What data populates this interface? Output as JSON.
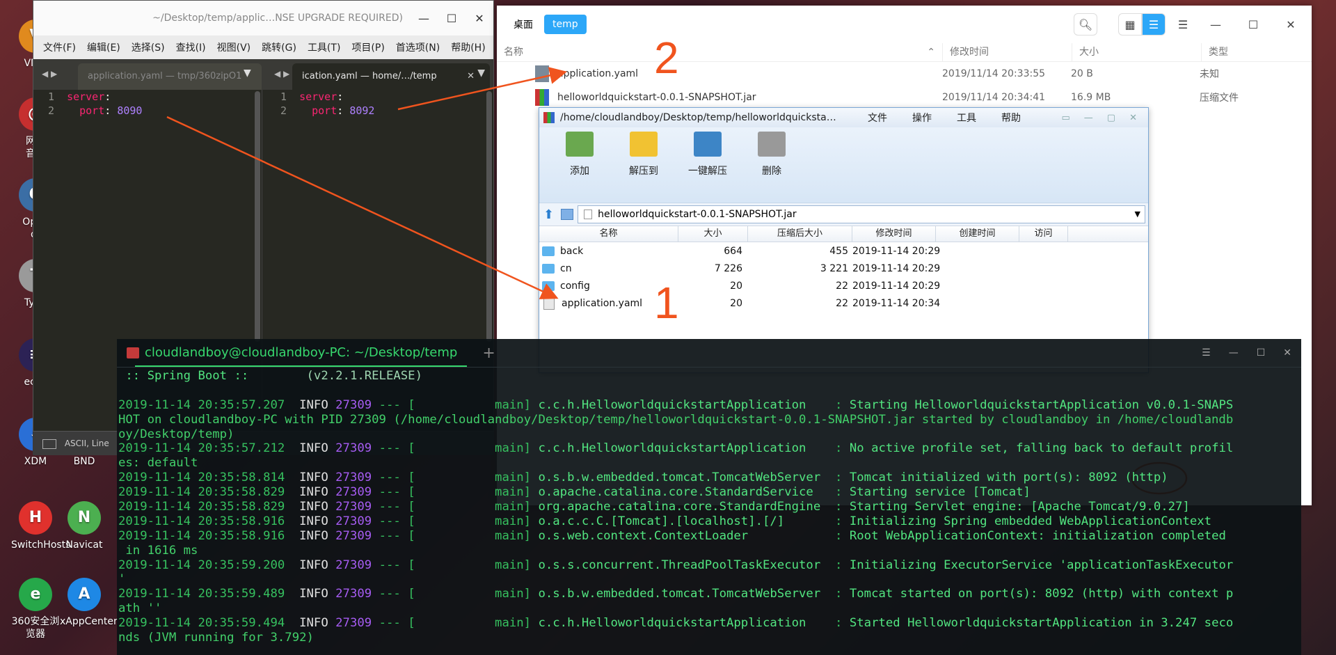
{
  "desktop_icons": [
    {
      "label": "VMw",
      "color": "#e08a1e",
      "glyph": "V"
    },
    {
      "label": "网易\n音乐",
      "color": "#c62f2f",
      "glyph": "@"
    },
    {
      "label": "Open\not",
      "color": "#3b6ea5",
      "glyph": "O"
    },
    {
      "label": "Type",
      "color": "#9a9a9a",
      "glyph": "T"
    },
    {
      "label": "eclip",
      "color": "#2c2255",
      "glyph": "≡"
    },
    {
      "label": "XDM",
      "color": "#2a6fd6",
      "glyph": "⇩"
    },
    {
      "label": "BND",
      "color": "#555555",
      "glyph": ""
    },
    {
      "label": "SwitchHosts",
      "color": "#e0312d",
      "glyph": "H"
    },
    {
      "label": "Navicat",
      "color": "#4caf50",
      "glyph": "N"
    },
    {
      "label": "360安全浏览器",
      "color": "#26a84a",
      "glyph": "e"
    },
    {
      "label": "xAppCenter",
      "color": "#1e88e5",
      "glyph": "A"
    }
  ],
  "editor": {
    "title": "~/Desktop/temp/applic…NSE UPGRADE REQUIRED)",
    "menus": [
      "文件(F)",
      "编辑(E)",
      "选择(S)",
      "查找(I)",
      "视图(V)",
      "跳转(G)",
      "工具(T)",
      "项目(P)",
      "首选项(N)",
      "帮助(H)"
    ],
    "tab_left": "application.yaml — tmp/360zipO1",
    "tab_right": "ication.yaml — home/…/temp",
    "left_lines": [
      {
        "num": "1",
        "key": "server",
        "value": ""
      },
      {
        "num": "2",
        "key": "  port",
        "value": "8090"
      }
    ],
    "right_lines": [
      {
        "num": "1",
        "key": "server",
        "value": ""
      },
      {
        "num": "2",
        "key": "  port",
        "value": "8092"
      }
    ],
    "status": "ASCII, Line"
  },
  "file_manager": {
    "breadcrumbs": [
      "桌面",
      "temp"
    ],
    "columns": [
      "名称",
      "修改时间",
      "大小",
      "类型"
    ],
    "files": [
      {
        "name": "application.yaml",
        "modified": "2019/11/14 20:33:55",
        "size": "20 B",
        "type": "未知"
      },
      {
        "name": "helloworldquickstart-0.0.1-SNAPSHOT.jar",
        "modified": "2019/11/14 20:34:41",
        "size": "16.9 MB",
        "type": "压缩文件"
      }
    ]
  },
  "archive": {
    "title": "/home/cloudlandboy/Desktop/temp/helloworldquicksta…",
    "menus": [
      "文件",
      "操作",
      "工具",
      "帮助"
    ],
    "toolbar": [
      "添加",
      "解压到",
      "一键解压",
      "删除"
    ],
    "address": "helloworldquickstart-0.0.1-SNAPSHOT.jar",
    "columns": [
      "名称",
      "大小",
      "压缩后大小",
      "修改时间",
      "创建时间",
      "访问"
    ],
    "rows": [
      {
        "name": "back",
        "size": "664",
        "packed": "455",
        "modified": "2019-11-14 20:29",
        "kind": "folder"
      },
      {
        "name": "cn",
        "size": "7 226",
        "packed": "3 221",
        "modified": "2019-11-14 20:29",
        "kind": "folder"
      },
      {
        "name": "config",
        "size": "20",
        "packed": "22",
        "modified": "2019-11-14 20:29",
        "kind": "folder"
      },
      {
        "name": "application.yaml",
        "size": "20",
        "packed": "22",
        "modified": "2019-11-14 20:34",
        "kind": "file"
      }
    ]
  },
  "annotations": {
    "label_1": "1",
    "label_2": "2",
    "accent": "#f0541e"
  },
  "terminal": {
    "tab_title": "cloudlandboy@cloudlandboy-PC: ~/Desktop/temp",
    "lines": [
      " :: Spring Boot ::        (v2.2.1.RELEASE)",
      "",
      "2019-11-14 20:35:57.207  INFO 27309 --- [           main] c.c.h.HelloworldquickstartApplication    : Starting HelloworldquickstartApplication v0.0.1-SNAPS",
      "HOT on cloudlandboy-PC with PID 27309 (/home/cloudlandboy/Desktop/temp/helloworldquickstart-0.0.1-SNAPSHOT.jar started by cloudlandboy in /home/cloudlandb",
      "oy/Desktop/temp)",
      "2019-11-14 20:35:57.212  INFO 27309 --- [           main] c.c.h.HelloworldquickstartApplication    : No active profile set, falling back to default profil",
      "es: default",
      "2019-11-14 20:35:58.814  INFO 27309 --- [           main] o.s.b.w.embedded.tomcat.TomcatWebServer  : Tomcat initialized with port(s): 8092 (http)",
      "2019-11-14 20:35:58.829  INFO 27309 --- [           main] o.apache.catalina.core.StandardService   : Starting service [Tomcat]",
      "2019-11-14 20:35:58.829  INFO 27309 --- [           main] org.apache.catalina.core.StandardEngine  : Starting Servlet engine: [Apache Tomcat/9.0.27]",
      "2019-11-14 20:35:58.916  INFO 27309 --- [           main] o.a.c.c.C.[Tomcat].[localhost].[/]       : Initializing Spring embedded WebApplicationContext",
      "2019-11-14 20:35:58.916  INFO 27309 --- [           main] o.s.web.context.ContextLoader            : Root WebApplicationContext: initialization completed",
      " in 1616 ms",
      "2019-11-14 20:35:59.200  INFO 27309 --- [           main] o.s.s.concurrent.ThreadPoolTaskExecutor  : Initializing ExecutorService 'applicationTaskExecutor",
      "'",
      "2019-11-14 20:35:59.489  INFO 27309 --- [           main] o.s.b.w.embedded.tomcat.TomcatWebServer  : Tomcat started on port(s): 8092 (http) with context p",
      "ath ''",
      "2019-11-14 20:35:59.494  INFO 27309 --- [           main] c.c.h.HelloworldquickstartApplication    : Started HelloworldquickstartApplication in 3.247 seco",
      "nds (JVM running for 3.792)"
    ]
  }
}
